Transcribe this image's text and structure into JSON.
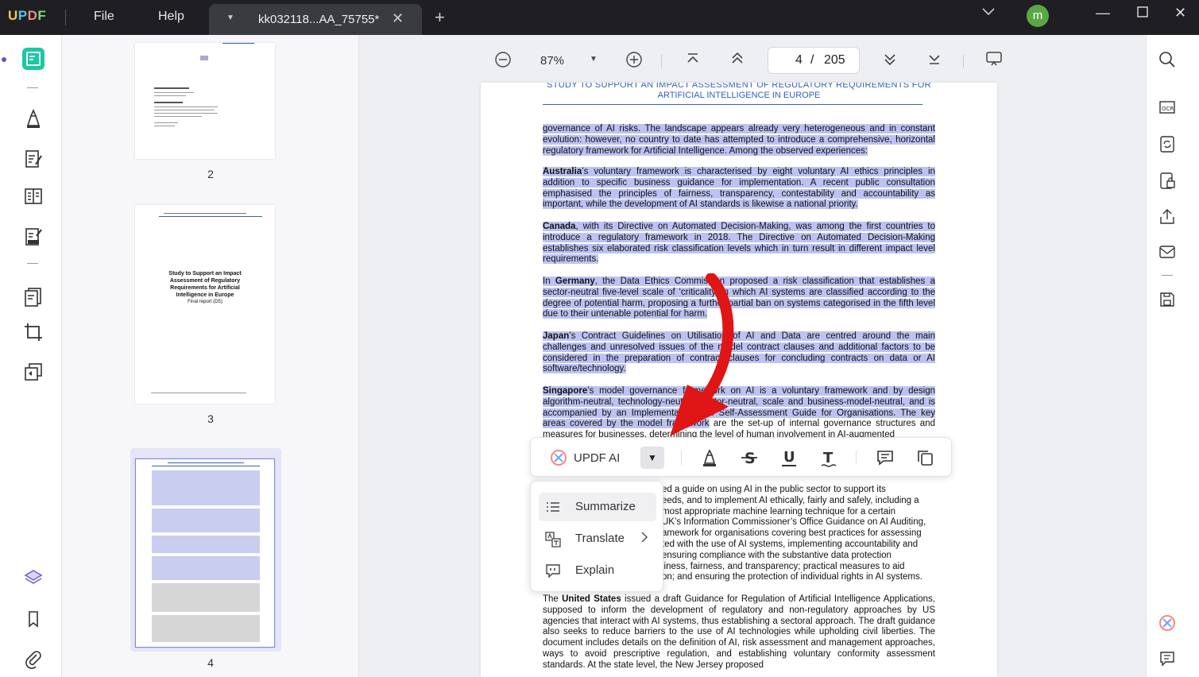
{
  "app": {
    "logo": "UPDF",
    "menu": [
      "File",
      "Help"
    ],
    "tab_title": "kk032118...AA_75755*",
    "avatar_letter": "m",
    "accent": "#1cc7a4"
  },
  "toolbar": {
    "zoom": "87%",
    "page_current": "4",
    "page_sep": "/",
    "page_total": "205"
  },
  "thumbnails": {
    "pages": [
      "2",
      "3",
      "4"
    ],
    "page3_title": "Study to Support an Impact Assessment of Regulatory Requirements for Artificial Intelligence in Europe",
    "page3_sub": "Final report (D5)"
  },
  "document": {
    "header_line1": "STUDY TO SUPPORT AN IMPACT ASSESSMENT OF REGULATORY REQUIREMENTS FOR",
    "header_line2": "ARTIFICIAL INTELLIGENCE IN EUROPE",
    "p1": "governance of AI risks. The landscape appears already very heterogeneous and in constant evolution: however, no country to date has attempted to introduce a comprehensive, horizontal regulatory framework for Artificial Intelligence. Among the observed experiences:",
    "p2_bold": "Australia",
    "p2": "’s voluntary framework is characterised by eight voluntary AI ethics principles in addition to specific business guidance for implementation. A recent public consultation emphasised the principles of fairness, transparency, contestability and accountability as important, while the development of AI standards is likewise a national priority.",
    "p3_bold": "Canada",
    "p3": ", with its Directive on Automated Decision-Making, was among the first countries to introduce a regulatory framework in 2018. The Directive on Automated Decision-Making establishes six elaborated risk classification levels which in turn result in different impact level requirements.",
    "p4_pre": "In ",
    "p4_bold": "Germany",
    "p4": ", the Data Ethics Commission proposed a risk classification that establishes a sector-neutral five-level scale of ‘criticality’ in which AI systems are classified according to the degree of potential harm, proposing a further partial ban on systems categorised in the fifth level due to their untenable potential for harm.",
    "p5_bold": "Japan",
    "p5": "’s Contract Guidelines on Utilisation of AI and Data are centred around the main challenges and unresolved issues of the model contract clauses and additional factors to be considered in the preparation of contract clauses for concluding contracts on data or AI software/technology.",
    "p6_bold": "Singapore",
    "p6_hl": "’s model governance framework on AI is a voluntary framework and by design algorithm-neutral, technology-neutral, sector-neutral, scale and business-model-neutral, and is accompanied by an Implementation and Self-Assessment Guide for Organisations. The key areas covered by the model framework",
    "p6_rest": " are the set-up of internal governance structures and measures for businesses, determining the level of human involvement in AI-augmented",
    "p7_lines": [
      "ed a guide on using AI in the public sector to support its",
      "eeds, and to implement AI ethically, fairly and safely, including a",
      "most appropriate machine learning technique for a certain",
      "UK’s Information Commissioner’s Office Guidance on AI Auditing,",
      "amework for organisations covering best practices for assessing",
      "ted with the use of AI systems, implementing accountability and",
      "ensuring compliance with the substantive data protection",
      "liness, fairness, and transparency; practical measures to aid",
      "on; and ensuring the protection of individual rights in AI systems."
    ],
    "p8_pre": "The ",
    "p8_bold": "United States",
    "p8": " issued a draft Guidance for Regulation of Artificial Intelligence Applications, supposed to inform the development of regulatory and non-regulatory approaches by US agencies that interact with AI systems, thus establishing a sectoral approach. The draft guidance also seeks to reduce barriers to the use of AI technologies while upholding civil liberties. The document includes details on the definition of AI, risk assessment and management approaches, ways to avoid prescriptive regulation, and establishing voluntary conformity assessment standards. At the state level, the New Jersey proposed"
  },
  "float_toolbar": {
    "ai_label": "UPDF AI",
    "tools": [
      "highlight",
      "strikethrough",
      "underline",
      "text",
      "comment",
      "copy"
    ]
  },
  "ai_menu": {
    "items": [
      {
        "label": "Summarize",
        "icon": "list-icon"
      },
      {
        "label": "Translate",
        "icon": "translate-icon",
        "submenu": ">"
      },
      {
        "label": "Explain",
        "icon": "explain-icon"
      }
    ]
  }
}
